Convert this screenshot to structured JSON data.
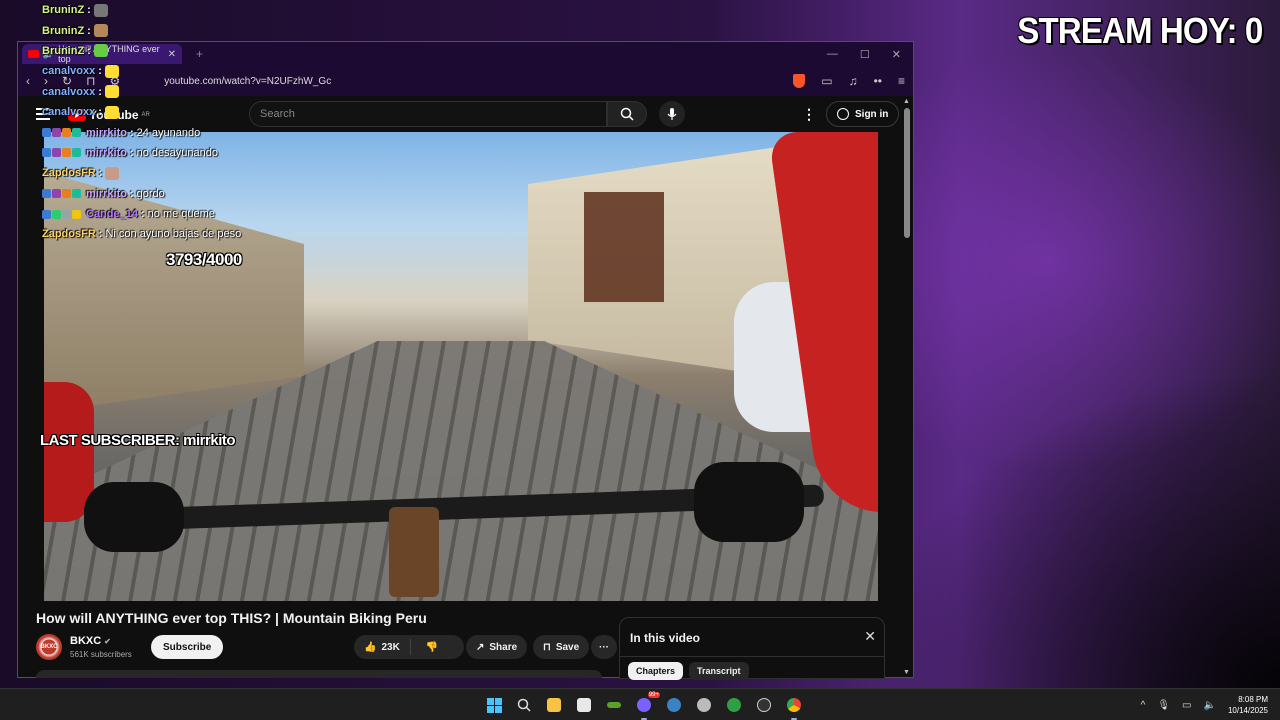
{
  "overlay": {
    "stream_title": "STREAM HOY: 0",
    "counter": "3793/4000",
    "last_subscriber": "LAST SUBSCRIBER: mirrkito"
  },
  "chat": [
    {
      "user": "BruninZ",
      "sep": ":",
      "msg": "",
      "color": "#d4f28a",
      "badges": [],
      "emote": "#777777"
    },
    {
      "user": "BruninZ",
      "sep": ":",
      "msg": "",
      "color": "#d4f28a",
      "badges": [],
      "emote": "#b3895a"
    },
    {
      "user": "BruninZ",
      "sep": ":",
      "msg": "",
      "color": "#d4f28a",
      "badges": [],
      "emote": "#66cc44"
    },
    {
      "user": "canalvoxx",
      "sep": ":",
      "msg": "",
      "color": "#7fb2ff",
      "badges": [],
      "emote": "#ffdd33"
    },
    {
      "user": "canalvoxx",
      "sep": ":",
      "msg": "",
      "color": "#7fb2ff",
      "badges": [],
      "emote": "#ffdd33"
    },
    {
      "user": "canalvoxx",
      "sep": ":",
      "msg": "",
      "color": "#7fb2ff",
      "badges": [],
      "emote": "#ffdd33"
    },
    {
      "user": "mirrkito",
      "sep": ":",
      "msg": "24 ayunando",
      "color": "#c9a6ff",
      "badges": [
        "#3a7bd5",
        "#8e44ad",
        "#e67e22",
        "#1abc9c"
      ],
      "emote": ""
    },
    {
      "user": "mirrkito",
      "sep": ":",
      "msg": "no desayunando",
      "color": "#c9a6ff",
      "badges": [
        "#3a7bd5",
        "#8e44ad",
        "#e67e22",
        "#1abc9c"
      ],
      "emote": ""
    },
    {
      "user": "ZapdosFR",
      "sep": ":",
      "msg": "",
      "color": "#ffd36b",
      "badges": [],
      "emote": "#c99a88"
    },
    {
      "user": "mirrkito",
      "sep": ":",
      "msg": "gordo",
      "color": "#c9a6ff",
      "badges": [
        "#3a7bd5",
        "#8e44ad",
        "#e67e22",
        "#1abc9c"
      ],
      "emote": ""
    },
    {
      "user": "Cande_14",
      "sep": ":",
      "msg": "no me queme",
      "color": "#b57aff",
      "badges": [
        "#3a7bd5",
        "#2ecc71",
        "#95a5a6",
        "#f1c40f"
      ],
      "emote": ""
    },
    {
      "user": "ZapdosFR",
      "sep": ":",
      "msg": "Ni con ayuno bajas de peso",
      "color": "#ffd36b",
      "badges": [],
      "emote": ""
    }
  ],
  "browser": {
    "tab_title": "How will ANYTHING ever top",
    "url": "youtube.com/watch?v=N2UFzhW_Gc"
  },
  "youtube": {
    "logo_text": "YouTube",
    "logo_region": "AR",
    "search_placeholder": "Search",
    "sign_in": "Sign in",
    "video_title": "How will ANYTHING ever top THIS? | Mountain Biking Peru",
    "channel_name": "BKXC",
    "channel_avatar_text": "BKXC",
    "subscribers": "561K subscribers",
    "subscribe_label": "Subscribe",
    "likes": "23K",
    "share_label": "Share",
    "save_label": "Save",
    "in_this_video": "In this video",
    "tabs": [
      "Chapters",
      "Transcript"
    ]
  },
  "taskbar": {
    "time": "8:08 PM",
    "date": "10/14/2025",
    "notification_badge": "99+"
  }
}
